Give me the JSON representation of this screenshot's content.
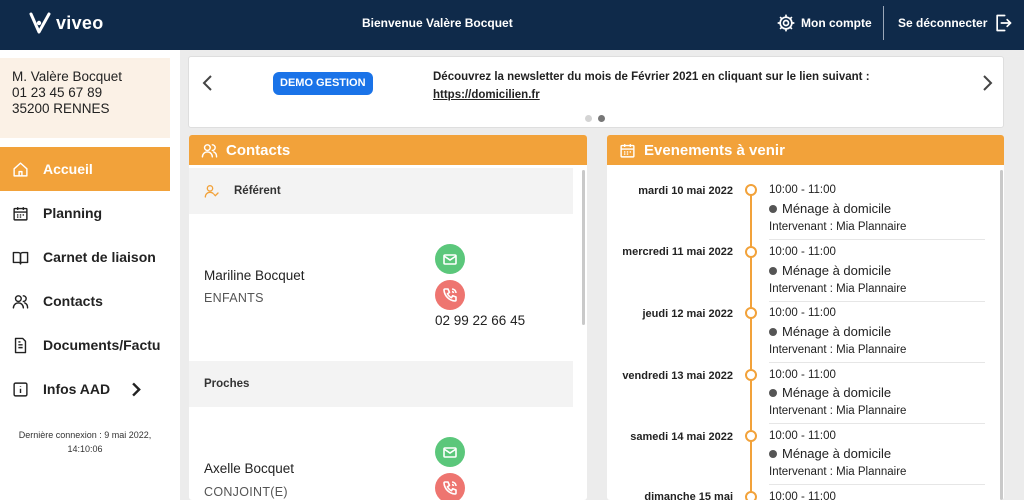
{
  "header": {
    "logo_text": "viveo",
    "welcome": "Bienvenue Valère Bocquet",
    "account_label": "Mon compte",
    "logout_label": "Se déconnecter"
  },
  "user": {
    "name": "M. Valère Bocquet",
    "phone": "01 23 45 67 89",
    "city": "35200 RENNES"
  },
  "nav": [
    {
      "label": "Accueil",
      "icon": "home-icon",
      "active": true
    },
    {
      "label": "Planning",
      "icon": "calendar-icon"
    },
    {
      "label": "Carnet de liaison",
      "icon": "book-icon"
    },
    {
      "label": "Contacts",
      "icon": "users-icon"
    },
    {
      "label": "Documents/Factures",
      "icon": "document-icon"
    },
    {
      "label": "Infos AAD",
      "icon": "info-icon"
    }
  ],
  "last_login": {
    "line1": "Dernière connexion : 9 mai 2022,",
    "line2": "14:10:06"
  },
  "news": {
    "badge": "DEMO GESTION",
    "text_before": "Découvrez la newsletter du mois de ",
    "text_month": "Février 2021",
    "text_after": " en cliquant sur le lien suivant :",
    "link": "https://domicilien.fr"
  },
  "contacts": {
    "title": "Contacts",
    "sections": [
      {
        "label": "Référent"
      },
      {
        "label": "Proches"
      }
    ],
    "people": [
      {
        "name": "Mariline Bocquet",
        "role": "ENFANTS",
        "phone": "02 99 22 66 45"
      },
      {
        "name": "Axelle Bocquet",
        "role": "CONJOINT(E)"
      }
    ]
  },
  "events": {
    "title": "Evenements à venir",
    "items": [
      {
        "date": "mardi 10 mai 2022",
        "time": "10:00 - 11:00",
        "title": "Ménage à domicile",
        "worker": "Intervenant : Mia Plannaire"
      },
      {
        "date": "mercredi 11 mai 2022",
        "time": "10:00 - 11:00",
        "title": "Ménage à domicile",
        "worker": "Intervenant : Mia Plannaire"
      },
      {
        "date": "jeudi 12 mai 2022",
        "time": "10:00 - 11:00",
        "title": "Ménage à domicile",
        "worker": "Intervenant : Mia Plannaire"
      },
      {
        "date": "vendredi 13 mai 2022",
        "time": "10:00 - 11:00",
        "title": "Ménage à domicile",
        "worker": "Intervenant : Mia Plannaire"
      },
      {
        "date": "samedi 14 mai 2022",
        "time": "10:00 - 11:00",
        "title": "Ménage à domicile",
        "worker": "Intervenant : Mia Plannaire"
      },
      {
        "date": "dimanche 15 mai",
        "time": "10:00 - 11:00"
      }
    ]
  },
  "colors": {
    "header": "#0f2a4a",
    "accent": "#f2a23a",
    "mail": "#5bc77b",
    "phone": "#ee7570",
    "badge": "#1a73e8"
  }
}
